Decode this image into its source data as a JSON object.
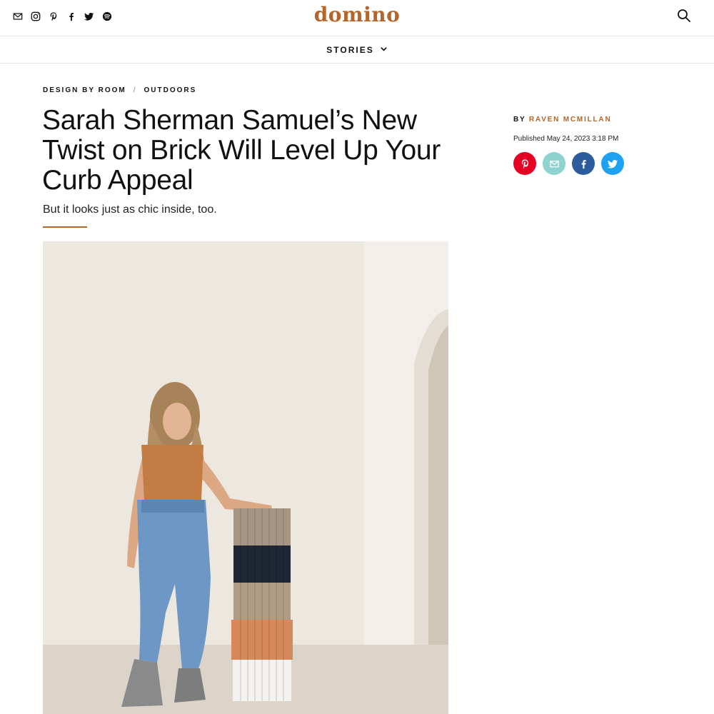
{
  "header": {
    "logo": "domino",
    "social_icons": [
      "mail-icon",
      "instagram-icon",
      "pinterest-icon",
      "facebook-icon",
      "twitter-icon",
      "spotify-icon"
    ],
    "search_icon": "search-icon",
    "brand_color": "#b5652a"
  },
  "nav": {
    "stories_label": "STORIES"
  },
  "breadcrumb": {
    "items": [
      "DESIGN BY ROOM",
      "OUTDOORS"
    ],
    "separator": "/"
  },
  "article": {
    "title": "Sarah Sherman Samuel’s New Twist on Brick Will Level Up Your Curb Appeal",
    "subtitle": "But it looks just as chic inside, too.",
    "byline_prefix": "BY",
    "author": "RAVEN MCMILLAN",
    "published": "Published May 24, 2023 3:18 PM"
  },
  "share": {
    "buttons": [
      {
        "name": "pinterest",
        "color": "#e60023"
      },
      {
        "name": "email",
        "color": "#8fd3d1"
      },
      {
        "name": "facebook",
        "color": "#2d5c9c"
      },
      {
        "name": "twitter",
        "color": "#1da1f2"
      }
    ]
  }
}
